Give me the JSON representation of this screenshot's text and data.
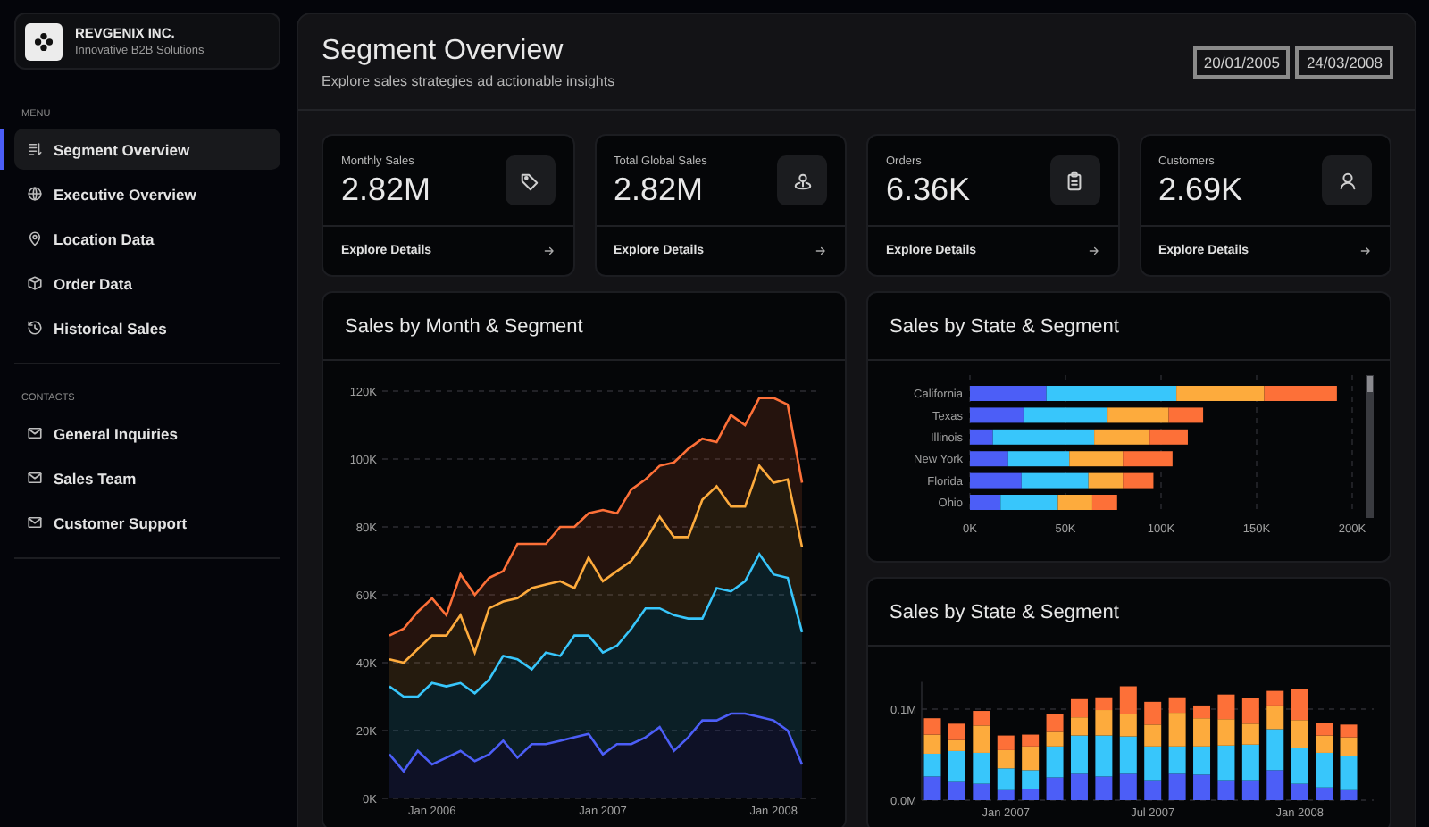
{
  "brand": {
    "name": "REVGENIX INC.",
    "tagline": "Innovative B2B Solutions"
  },
  "sidebar": {
    "sections": [
      {
        "heading": "MENU",
        "items": [
          {
            "label": "Segment Overview",
            "selected": true
          },
          {
            "label": "Executive Overview",
            "selected": false
          },
          {
            "label": "Location Data",
            "selected": false
          },
          {
            "label": "Order Data",
            "selected": false
          },
          {
            "label": "Historical Sales",
            "selected": false
          }
        ]
      },
      {
        "heading": "CONTACTS",
        "items": [
          {
            "label": "General Inquiries",
            "selected": false
          },
          {
            "label": "Sales Team",
            "selected": false
          },
          {
            "label": "Customer Support",
            "selected": false
          }
        ]
      }
    ]
  },
  "header": {
    "title": "Segment Overview",
    "subtitle": "Explore sales strategies ad actionable insights",
    "date_range": [
      "20/01/2005",
      "24/03/2008"
    ]
  },
  "kpis": [
    {
      "label": "Monthly Sales",
      "value": "2.82M",
      "link": "Explore Details"
    },
    {
      "label": "Total Global Sales",
      "value": "2.82M",
      "link": "Explore Details"
    },
    {
      "label": "Orders",
      "value": "6.36K",
      "link": "Explore Details"
    },
    {
      "label": "Customers",
      "value": "2.69K",
      "link": "Explore Details"
    }
  ],
  "charts": [
    {
      "title": "Sales by Month & Segment",
      "chart_data": {
        "type": "area",
        "stacked": true,
        "grid": true,
        "categories": [
          null,
          null,
          null,
          "Jan 2006",
          null,
          null,
          null,
          null,
          null,
          null,
          null,
          null,
          null,
          null,
          null,
          "Jan 2007",
          null,
          null,
          null,
          null,
          null,
          null,
          null,
          null,
          null,
          null,
          null,
          "Jan 2008",
          null,
          null
        ],
        "series": [
          {
            "color": "#4c5ef7",
            "values": [
              13000,
              8000,
              14000,
              10000,
              12000,
              14000,
              11000,
              13000,
              17000,
              12000,
              16000,
              16000,
              17000,
              18000,
              19000,
              13000,
              16000,
              16000,
              18000,
              21000,
              14000,
              18000,
              23000,
              23000,
              25000,
              25000,
              24000,
              23000,
              20000,
              10000
            ]
          },
          {
            "color": "#38c6fb",
            "values": [
              20000,
              22000,
              16000,
              24000,
              21000,
              20000,
              20000,
              22000,
              25000,
              29000,
              22000,
              27000,
              25000,
              30000,
              29000,
              30000,
              29000,
              34000,
              38000,
              35000,
              40000,
              35000,
              30000,
              39000,
              36000,
              39000,
              48000,
              43000,
              45000,
              39000
            ]
          },
          {
            "color": "#fdab3d",
            "values": [
              8000,
              10000,
              14000,
              14000,
              15000,
              20000,
              12000,
              21000,
              16000,
              18000,
              24000,
              20000,
              22000,
              14000,
              23000,
              21000,
              22000,
              20000,
              20000,
              27000,
              23000,
              24000,
              35000,
              30000,
              25000,
              22000,
              26000,
              27000,
              29000,
              25000
            ]
          },
          {
            "color": "#fd7038",
            "values": [
              7000,
              10000,
              11000,
              11000,
              6000,
              12000,
              17000,
              9000,
              9000,
              16000,
              13000,
              12000,
              16000,
              18000,
              13000,
              21000,
              17000,
              21000,
              18000,
              15000,
              22000,
              26000,
              18000,
              13000,
              27000,
              24000,
              20000,
              25000,
              22000,
              19000
            ]
          }
        ],
        "ylim": [
          0,
          120000
        ],
        "yticks": [
          {
            "value": 0,
            "label": "0K"
          },
          {
            "value": 20000,
            "label": "20K"
          },
          {
            "value": 40000,
            "label": "40K"
          },
          {
            "value": 60000,
            "label": "60K"
          },
          {
            "value": 80000,
            "label": "80K"
          },
          {
            "value": 100000,
            "label": "100K"
          },
          {
            "value": 120000,
            "label": "120K"
          }
        ]
      }
    },
    {
      "title": "Sales by State & Segment",
      "chart_data": {
        "type": "bar",
        "orientation": "horizontal",
        "stacked": true,
        "grid": true,
        "categories": [
          "California",
          "Texas",
          "Illinois",
          "New York",
          "Florida",
          "Ohio"
        ],
        "series": [
          {
            "color": "#4c5ef7",
            "values": [
              40000,
              28000,
              12000,
              20000,
              27000,
              16000
            ]
          },
          {
            "color": "#38c6fb",
            "values": [
              68000,
              44000,
              53000,
              32000,
              35000,
              30000
            ]
          },
          {
            "color": "#fdab3d",
            "values": [
              46000,
              32000,
              29000,
              28000,
              18000,
              18000
            ]
          },
          {
            "color": "#fd7038",
            "values": [
              38000,
              18000,
              20000,
              26000,
              16000,
              13000
            ]
          }
        ],
        "xlim": [
          0,
          200000
        ],
        "xticks": [
          {
            "value": 0,
            "label": "0K"
          },
          {
            "value": 50000,
            "label": "50K"
          },
          {
            "value": 100000,
            "label": "100K"
          },
          {
            "value": 150000,
            "label": "150K"
          },
          {
            "value": 200000,
            "label": "200K"
          }
        ]
      }
    },
    {
      "title": "Sales by State & Segment",
      "chart_data": {
        "type": "bar",
        "orientation": "vertical",
        "stacked": true,
        "grid": true,
        "categories": [
          null,
          null,
          null,
          "Jan 2007",
          null,
          null,
          null,
          null,
          null,
          "Jul 2007",
          null,
          null,
          null,
          null,
          null,
          "Jan 2008",
          null,
          null
        ],
        "series": [
          {
            "color": "#4c5ef7",
            "values": [
              26000,
              20000,
              18000,
              11000,
              12000,
              25000,
              29000,
              26000,
              29000,
              22000,
              29000,
              28000,
              22000,
              22000,
              33000,
              18000,
              14000,
              11000
            ]
          },
          {
            "color": "#38c6fb",
            "values": [
              25000,
              34000,
              34000,
              24000,
              21000,
              34000,
              42000,
              45000,
              41000,
              37000,
              30000,
              31000,
              38000,
              39000,
              45000,
              39000,
              38000,
              38000
            ]
          },
          {
            "color": "#fdab3d",
            "values": [
              21000,
              12000,
              30000,
              20000,
              26000,
              16000,
              20000,
              28000,
              25000,
              24000,
              37000,
              31000,
              29000,
              23000,
              26000,
              31000,
              19000,
              20000
            ]
          },
          {
            "color": "#fd7038",
            "values": [
              18000,
              18000,
              16000,
              16000,
              13000,
              20000,
              20000,
              14000,
              30000,
              25000,
              17000,
              14000,
              27000,
              28000,
              16000,
              34000,
              14000,
              14000
            ]
          }
        ],
        "ylim": [
          0,
          130000
        ],
        "yticks": [
          {
            "value": 0,
            "label": "0.0M"
          },
          {
            "value": 100000,
            "label": "0.1M"
          }
        ]
      }
    }
  ]
}
